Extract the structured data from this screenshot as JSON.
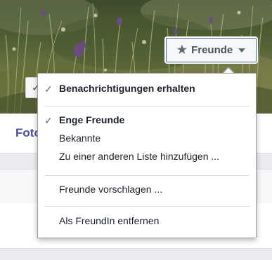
{
  "cover": {
    "friends_button": {
      "icon": "star-icon",
      "label": "Freunde"
    },
    "follow_button": {
      "icon": "chevron-down-icon",
      "label": "✓"
    }
  },
  "profile": {
    "tab_label": "Fotos"
  },
  "menu": {
    "sections": [
      {
        "items": [
          {
            "label": "Benachrichtigungen erhalten",
            "checked": true,
            "bold": true
          }
        ]
      },
      {
        "items": [
          {
            "label": "Enge Freunde",
            "checked": true,
            "bold": true
          },
          {
            "label": "Bekannte",
            "checked": false,
            "bold": false
          },
          {
            "label": "Zu einer anderen Liste hinzufügen ...",
            "checked": false,
            "bold": false
          }
        ]
      },
      {
        "items": [
          {
            "label": "Freunde vorschlagen ...",
            "checked": false,
            "bold": false
          }
        ]
      },
      {
        "items": [
          {
            "label": "Als FreundIn entfernen",
            "checked": false,
            "bold": false
          }
        ]
      }
    ],
    "check_glyph": "✓"
  },
  "colors": {
    "accent": "#4267b2",
    "tab_text": "#4b4f9c",
    "menu_border": "#9a9ea6"
  }
}
